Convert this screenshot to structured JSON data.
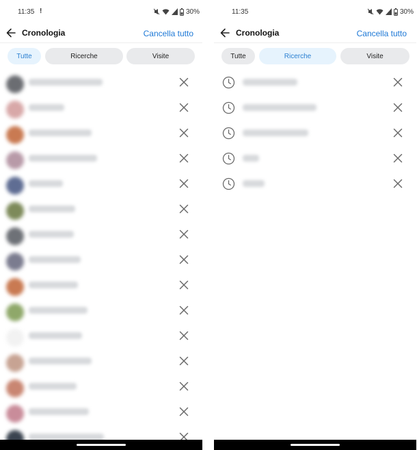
{
  "screens": [
    {
      "status": {
        "time": "11:35",
        "notification": "!",
        "battery": "30%"
      },
      "header": {
        "title": "Cronologia",
        "clear_all": "Cancella tutto"
      },
      "tabs": [
        {
          "label": "Tutte",
          "active": true
        },
        {
          "label": "Ricerche",
          "active": false
        },
        {
          "label": "Visite",
          "active": false
        }
      ],
      "items": [
        {
          "type": "visit",
          "thumb_color": "#6b6d72"
        },
        {
          "type": "visit",
          "thumb_color": "#d8a8a8"
        },
        {
          "type": "visit",
          "thumb_color": "#c97a52"
        },
        {
          "type": "visit",
          "thumb_color": "#b89aa8"
        },
        {
          "type": "visit",
          "thumb_color": "#5f6d93"
        },
        {
          "type": "visit",
          "thumb_color": "#7d8a5a"
        },
        {
          "type": "visit",
          "thumb_color": "#6e7177"
        },
        {
          "type": "visit",
          "thumb_color": "#7b7c8f"
        },
        {
          "type": "visit",
          "thumb_color": "#c97a52"
        },
        {
          "type": "visit",
          "thumb_color": "#8fa86a"
        },
        {
          "type": "visit",
          "thumb_color": "#f2f2f2"
        },
        {
          "type": "visit",
          "thumb_color": "#c7a393"
        },
        {
          "type": "visit",
          "thumb_color": "#c98672"
        },
        {
          "type": "visit",
          "thumb_color": "#c98c9a"
        },
        {
          "type": "visit",
          "thumb_color": "#3b4450"
        }
      ]
    },
    {
      "status": {
        "time": "11:35",
        "notification": "",
        "battery": "30%"
      },
      "header": {
        "title": "Cronologia",
        "clear_all": "Cancella tutto"
      },
      "tabs": [
        {
          "label": "Tutte",
          "active": false
        },
        {
          "label": "Ricerche",
          "active": true
        },
        {
          "label": "Visite",
          "active": false
        }
      ],
      "items": [
        {
          "type": "search"
        },
        {
          "type": "search"
        },
        {
          "type": "search"
        },
        {
          "type": "search"
        },
        {
          "type": "search"
        }
      ]
    }
  ],
  "colors": {
    "accent": "#1d78d6",
    "active_tab_bg": "#e6f3fd",
    "tab_bg": "#e9eaec",
    "icon_gray": "#6a6a6a"
  },
  "icons": {
    "back": "arrow-left-icon",
    "remove": "close-icon",
    "search_item": "clock-icon",
    "status": [
      "mute-icon",
      "wifi-icon",
      "signal-icon",
      "battery-icon"
    ]
  }
}
